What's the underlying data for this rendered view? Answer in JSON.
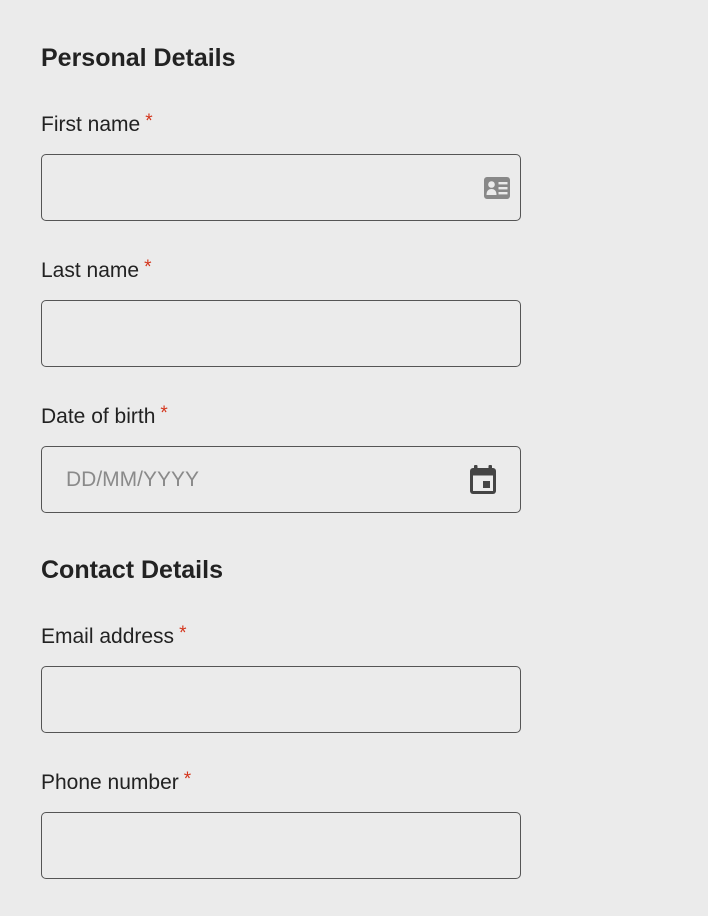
{
  "personal": {
    "title": "Personal Details",
    "first_name": {
      "label": "First name",
      "required": "*",
      "value": "",
      "placeholder": "",
      "icon": "contact-card-icon"
    },
    "last_name": {
      "label": "Last name",
      "required": "*",
      "value": "",
      "placeholder": ""
    },
    "dob": {
      "label": "Date of birth",
      "required": "*",
      "value": "",
      "placeholder": "DD/MM/YYYY",
      "icon": "calendar-icon"
    }
  },
  "contact": {
    "title": "Contact Details",
    "email": {
      "label": "Email address",
      "required": "*",
      "value": "",
      "placeholder": ""
    },
    "phone": {
      "label": "Phone number",
      "required": "*",
      "value": "",
      "placeholder": ""
    }
  },
  "colors": {
    "background": "#ebebeb",
    "text": "#222222",
    "required": "#d4351c",
    "border": "#555555",
    "placeholder": "#8a8a8a",
    "icon": "#888888",
    "calendar_icon": "#444444"
  }
}
